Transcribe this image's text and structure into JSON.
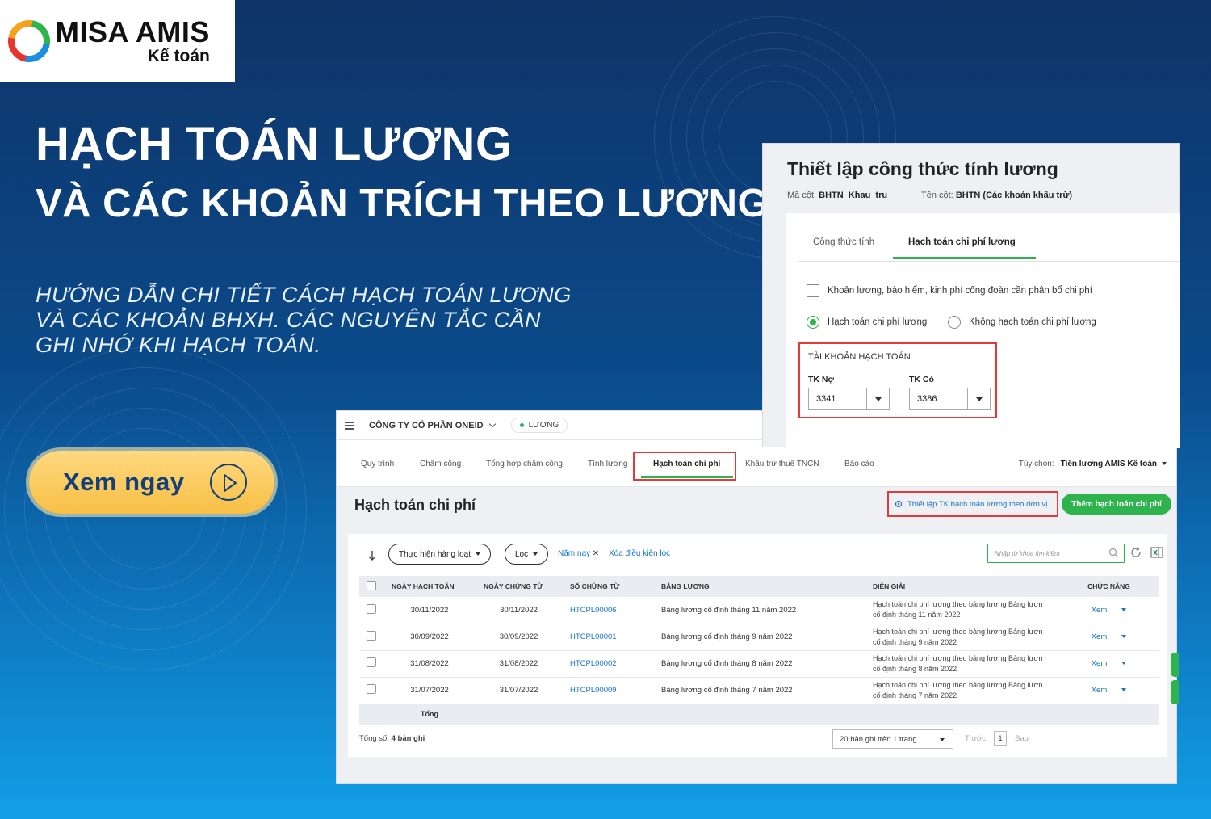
{
  "brand": {
    "name": "MISA AMIS",
    "product": "Kế toán"
  },
  "hero": {
    "title_line1": "HẠCH TOÁN LƯƠNG",
    "title_line2": "VÀ CÁC KHOẢN TRÍCH THEO LƯƠNG",
    "subtitle_line1": "HƯỚNG DẪN CHI TIẾT CÁCH HẠCH TOÁN LƯƠNG",
    "subtitle_line2": "VÀ CÁC KHOẢN BHXH. CÁC NGUYÊN TẮC CẦN",
    "subtitle_line3": "GHI NHỚ KHI HẠCH TOÁN.",
    "cta": "Xem ngay"
  },
  "app": {
    "company": "CÔNG TY CỔ PHẦN ONEID",
    "module": "LƯƠNG",
    "nav": [
      "Quy trình",
      "Chấm công",
      "Tổng hợp chấm công",
      "Tính lương",
      "Hạch toán chi phí",
      "Khấu trừ thuế TNCN",
      "Báo cáo"
    ],
    "option_label": "Tùy chọn:",
    "option_value": "Tiền lương AMIS Kế toán",
    "page_title": "Hạch toán chi phí",
    "setup_link": "Thiết lập TK hạch toán lương theo đơn vị",
    "add_button": "Thêm hạch toán chi phí",
    "bulk_button": "Thực hiện hàng loạt",
    "filter_button": "Lọc",
    "filter_tag": "Năm nay",
    "clear_filter": "Xóa điều kiện lọc",
    "search_placeholder": "Nhập từ khóa tìm kiếm",
    "columns": [
      "NGÀY HẠCH TOÁN",
      "NGÀY CHỨNG TỪ",
      "SỐ CHỨNG TỪ",
      "BẢNG LƯƠNG",
      "DIỄN GIẢI",
      "CHỨC NĂNG"
    ],
    "rows": [
      {
        "posting_date": "30/11/2022",
        "doc_date": "30/11/2022",
        "doc_no": "HTCPL00006",
        "payroll": "Bảng lương cố định tháng 11 năm 2022",
        "desc1": "Hạch toán chi phí lương theo bảng lương Bảng lươn",
        "desc2": "cố định tháng 11 năm 2022",
        "action": "Xem"
      },
      {
        "posting_date": "30/09/2022",
        "doc_date": "30/09/2022",
        "doc_no": "HTCPL00001",
        "payroll": "Bảng lương cố định tháng 9 năm 2022",
        "desc1": "Hạch toán chi phí lương theo bảng lương Bảng lươn",
        "desc2": "cố định tháng 9 năm 2022",
        "action": "Xem"
      },
      {
        "posting_date": "31/08/2022",
        "doc_date": "31/08/2022",
        "doc_no": "HTCPL00002",
        "payroll": "Bảng lương cố định tháng 8 năm 2022",
        "desc1": "Hạch toán chi phí lương theo bảng lương Bảng lươn",
        "desc2": "cố định tháng 8 năm 2022",
        "action": "Xem"
      },
      {
        "posting_date": "31/07/2022",
        "doc_date": "31/07/2022",
        "doc_no": "HTCPL00009",
        "payroll": "Bảng lương cố định tháng 7 năm 2022",
        "desc1": "Hạch toán chi phí lương theo bảng lương Bảng lươn",
        "desc2": "cố định tháng 7 năm 2022",
        "action": "Xem"
      }
    ],
    "total_label": "Tổng",
    "record_count_label": "Tổng số:",
    "record_count_value": "4 bản ghi",
    "page_size": "20 bản ghi trên 1 trang",
    "prev": "Trước",
    "page": "1",
    "next": "Sau"
  },
  "dialog": {
    "title": "Thiết lập công thức tính lương",
    "code_label": "Mã cột:",
    "code_value": "BHTN_Khau_tru",
    "name_label": "Tên cột:",
    "name_value": "BHTN (Các khoản khấu trừ)",
    "tab1": "Công thức tính",
    "tab2": "Hạch toán chi phí lương",
    "checkbox_label": "Khoản lương, bảo hiểm, kinh phí công đoàn cần phân bổ chi phí",
    "radio_on": "Hạch toán chi phí lương",
    "radio_off": "Không hạch toán chi phí lương",
    "account_section": "TÀI KHOẢN HẠCH TOÁN",
    "debit_label": "TK Nợ",
    "debit_value": "3341",
    "credit_label": "TK Có",
    "credit_value": "3386"
  }
}
